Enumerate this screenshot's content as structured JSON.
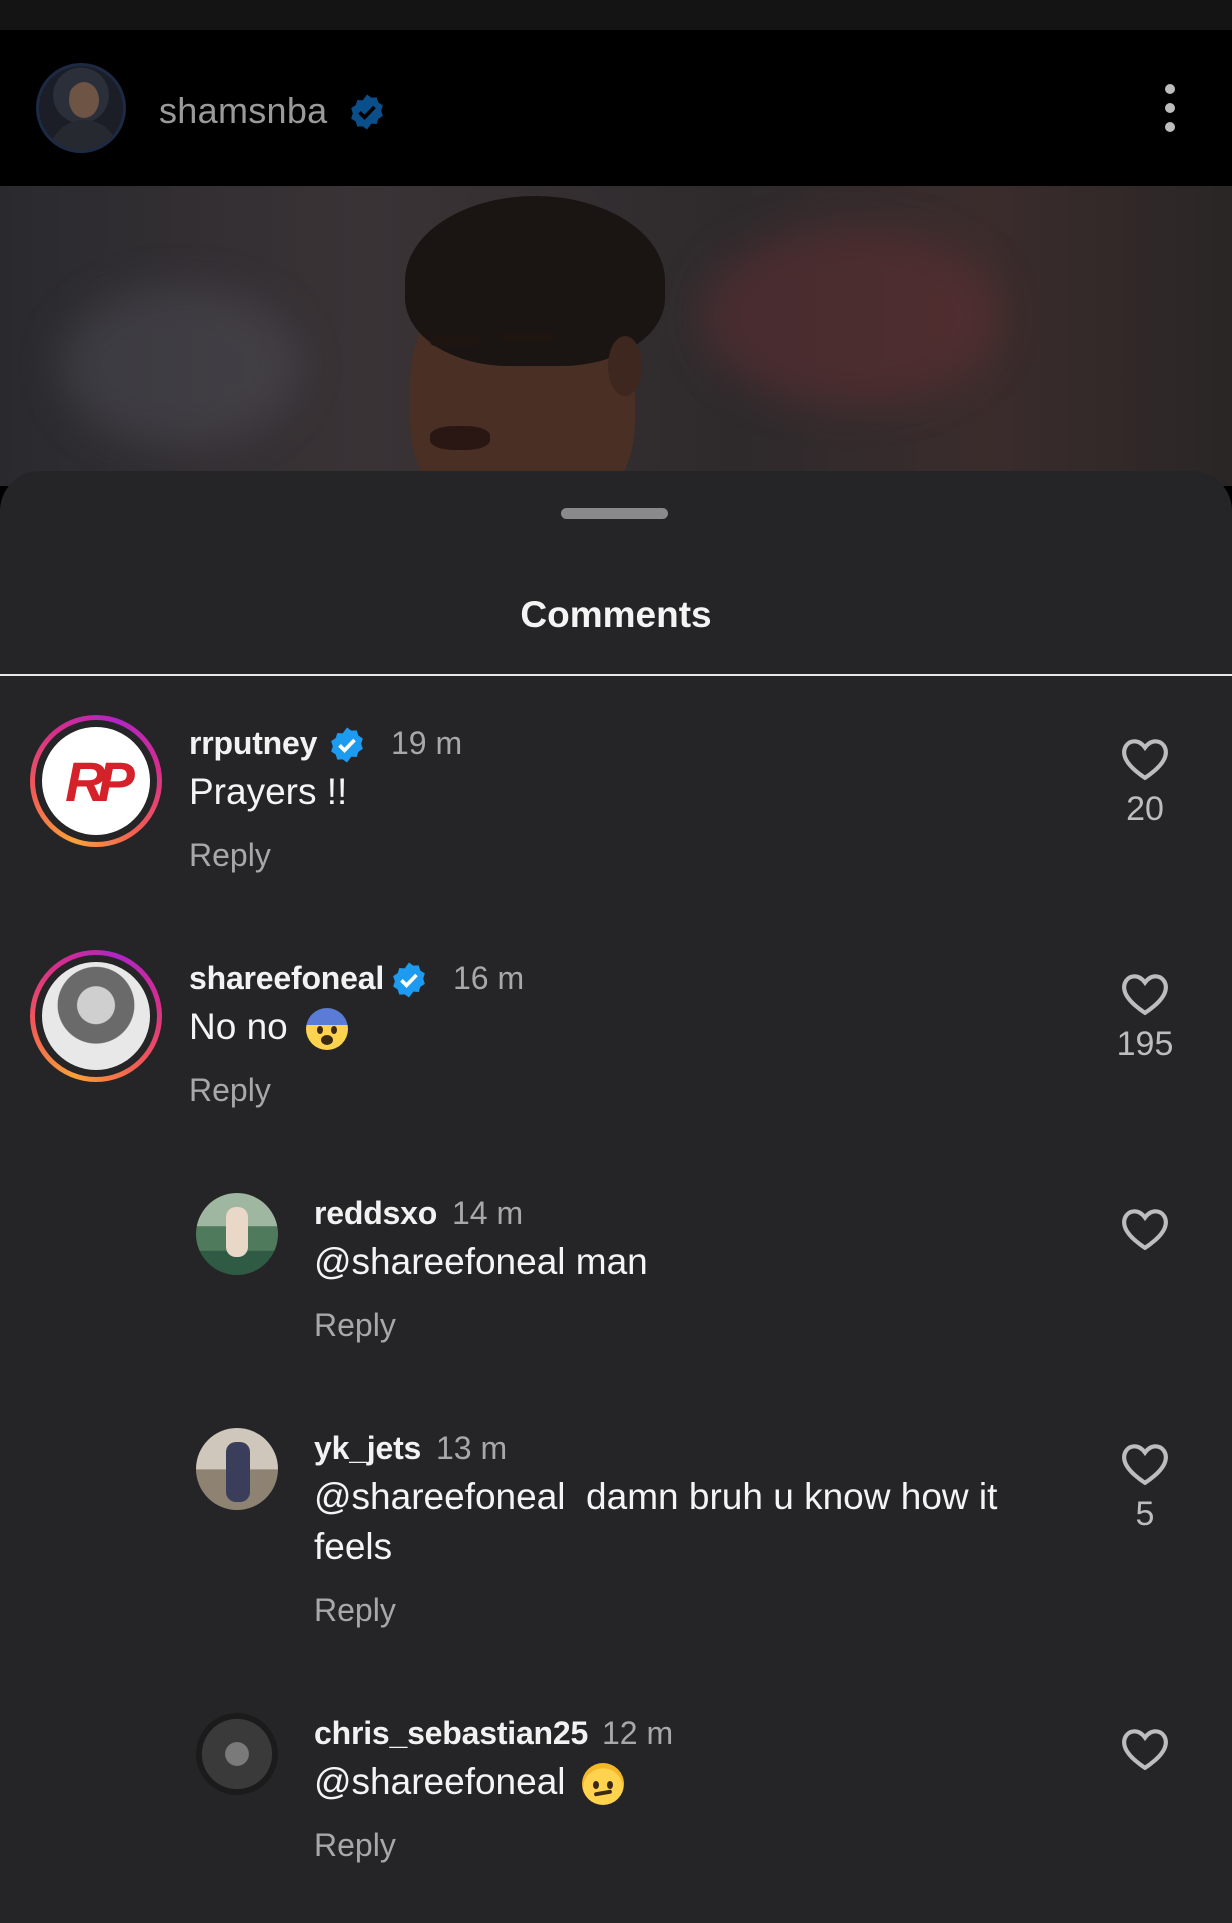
{
  "post": {
    "username": "shamsnba",
    "verified": true
  },
  "sheet": {
    "title": "Comments"
  },
  "comments": [
    {
      "user": "rrputney",
      "verified": true,
      "time": "19 m",
      "text": "Prayers !!",
      "reply": "Reply",
      "likes": "20",
      "avatar_text": "RP"
    },
    {
      "user": "shareefoneal",
      "verified": true,
      "time": "16 m",
      "text": "No no",
      "emoji": "fearful-face",
      "reply": "Reply",
      "likes": "195"
    },
    {
      "user": "reddsxo",
      "verified": false,
      "time": "14 m",
      "text": "@shareefoneal man",
      "reply": "Reply",
      "likes": ""
    },
    {
      "user": "yk_jets",
      "verified": false,
      "time": "13 m",
      "text_line1": "@shareefoneal  damn bruh u know how it",
      "text_line2": "feels",
      "reply": "Reply",
      "likes": "5"
    },
    {
      "user": "chris_sebastian25",
      "verified": false,
      "time": "12 m",
      "text": "@shareefoneal",
      "emoji": "confused-face",
      "reply": "Reply",
      "likes": ""
    }
  ],
  "colors": {
    "sheet_bg": "#252527",
    "verified_blue": "#1d9bf0",
    "muted": "#a8a8a8"
  },
  "icons": [
    "verified-icon",
    "more-icon",
    "heart-icon"
  ]
}
